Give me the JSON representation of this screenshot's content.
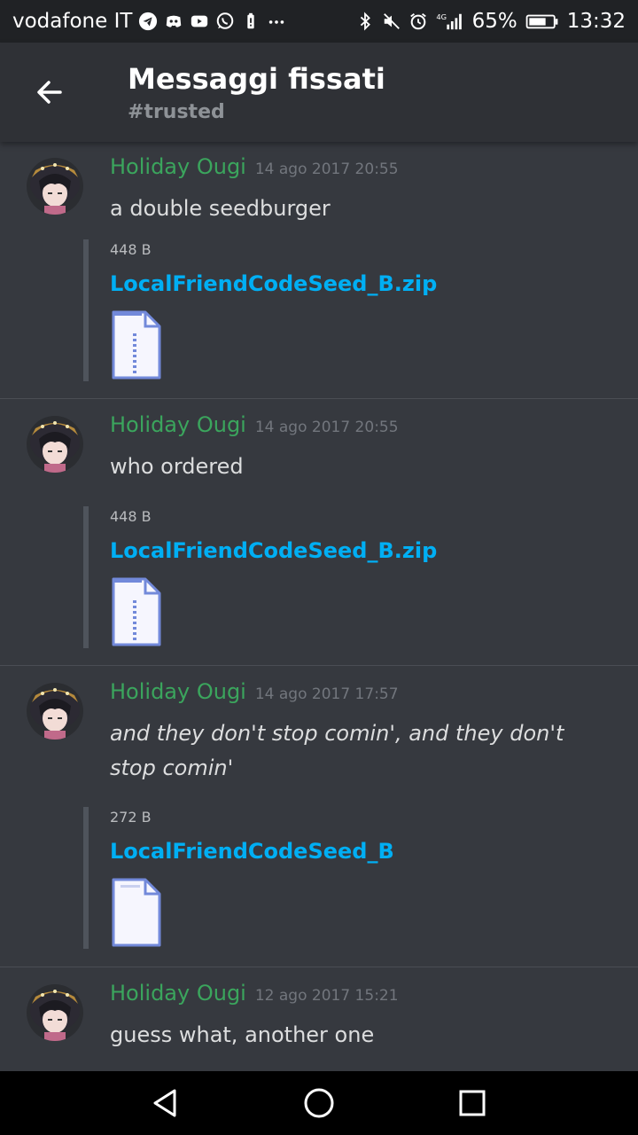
{
  "status_bar": {
    "carrier": "vodafone IT",
    "battery": "65%",
    "time": "13:32",
    "network": "4G",
    "left_icons": [
      "telegram-icon",
      "discord-icon",
      "youtube-icon",
      "whatsapp-icon",
      "battery-saver-icon",
      "more-dots-icon"
    ],
    "right_icons": [
      "bluetooth-icon",
      "mute-icon",
      "alarm-icon",
      "signal-icon",
      "battery-icon"
    ]
  },
  "header": {
    "title": "Messaggi fissati",
    "subtitle": "#trusted",
    "back_icon": "back-arrow-icon"
  },
  "colors": {
    "background": "#36393f",
    "header": "#2f3136",
    "author": "#3ba55d",
    "link": "#00aff4",
    "text": "#dcddde",
    "timestamp": "#72767d"
  },
  "messages": [
    {
      "author": "Holiday Ougi",
      "timestamp": "14 ago 2017 20:55",
      "text": "a double seedburger",
      "italic": false,
      "attachment": {
        "size": "448 B",
        "filename": "LocalFriendCodeSeed_B.zip",
        "file_type": "zip"
      }
    },
    {
      "author": "Holiday Ougi",
      "timestamp": "14 ago 2017 20:55",
      "text": "who ordered",
      "italic": false,
      "attachment": {
        "size": "448 B",
        "filename": "LocalFriendCodeSeed_B.zip",
        "file_type": "zip"
      }
    },
    {
      "author": "Holiday Ougi",
      "timestamp": "14 ago 2017 17:57",
      "text": "and they don't stop comin', and they don't stop comin'",
      "italic": true,
      "attachment": {
        "size": "272 B",
        "filename": "LocalFriendCodeSeed_B",
        "file_type": "generic"
      }
    },
    {
      "author": "Holiday Ougi",
      "timestamp": "12 ago 2017 15:21",
      "text": "guess what, another one",
      "italic": false
    }
  ],
  "nav_bar": {
    "buttons": [
      "back-triangle-icon",
      "home-circle-icon",
      "recents-square-icon"
    ]
  }
}
